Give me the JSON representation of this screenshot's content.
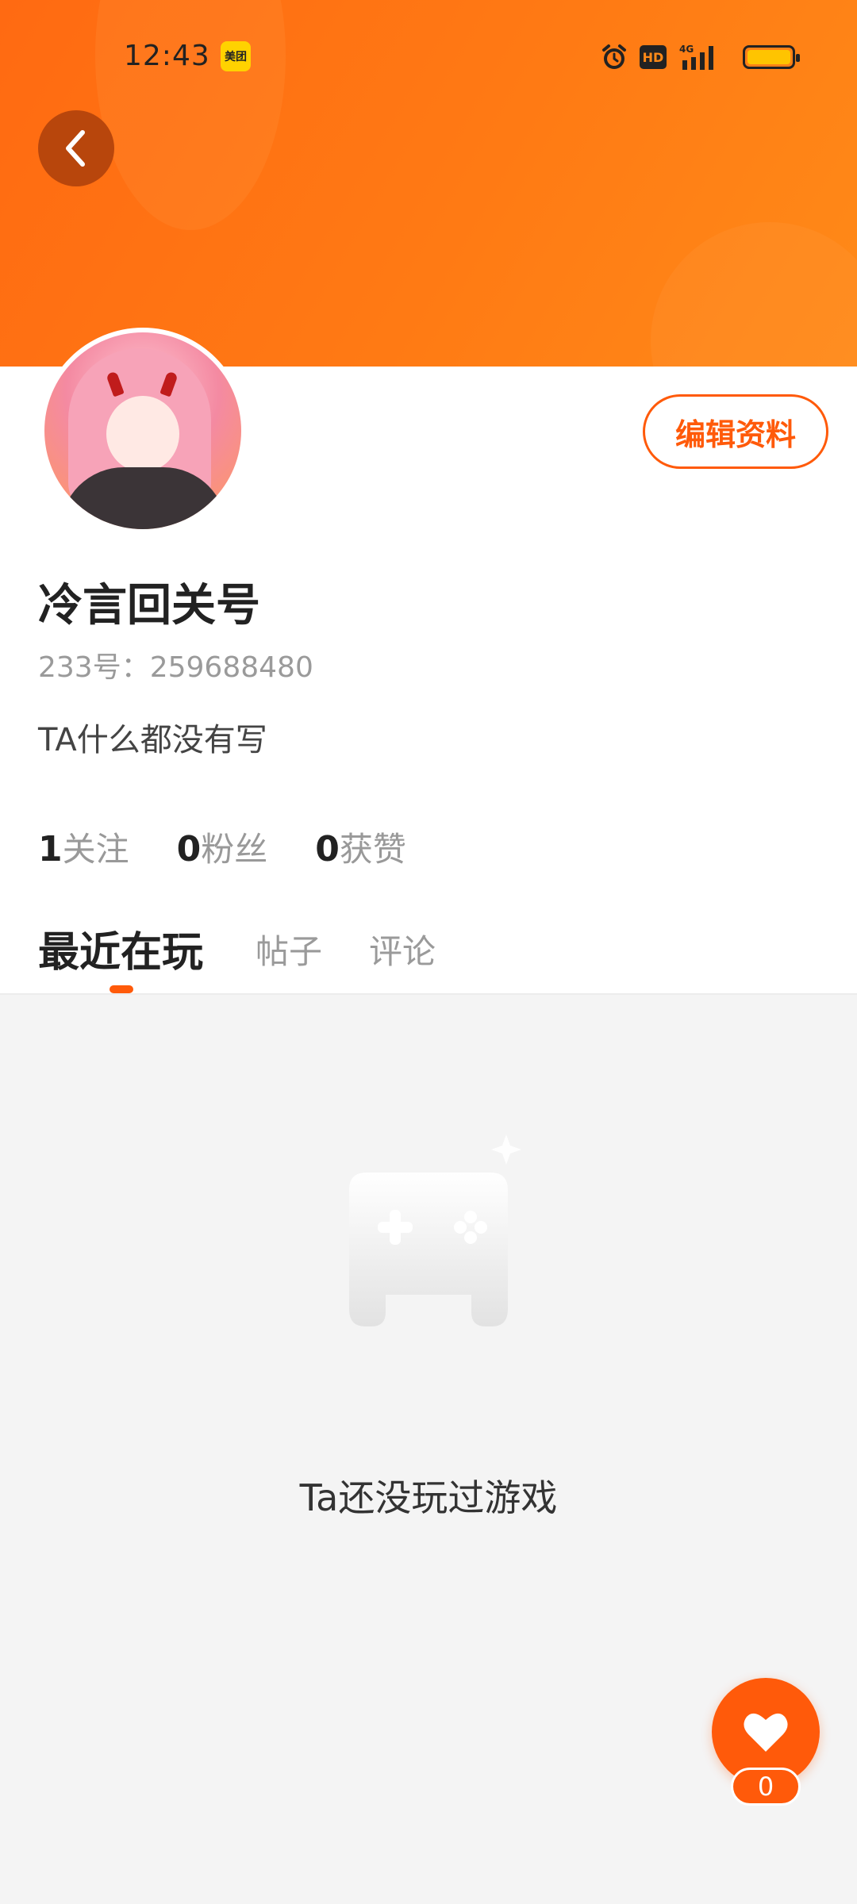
{
  "status_bar": {
    "time": "12:43",
    "app_badge": "美团",
    "icons": [
      "alarm-icon",
      "hd-icon",
      "signal-4g-icon",
      "battery-icon"
    ],
    "hd_label": "HD"
  },
  "header": {
    "back_icon": "chevron-left-icon",
    "accent": "#ff6a12"
  },
  "profile": {
    "edit_button": "编辑资料",
    "username": "冷言回关号",
    "user_id": "233号：259688480",
    "bio": "TA什么都没有写",
    "stats": [
      {
        "num": "1",
        "label": "关注"
      },
      {
        "num": "0",
        "label": "粉丝"
      },
      {
        "num": "0",
        "label": "获赞"
      }
    ]
  },
  "tabs": [
    {
      "label": "最近在玩",
      "active": true
    },
    {
      "label": "帖子",
      "active": false
    },
    {
      "label": "评论",
      "active": false
    }
  ],
  "empty_state": {
    "icon": "gamepad-icon",
    "text": "Ta还没玩过游戏"
  },
  "like": {
    "icon": "heart-icon",
    "count": "0"
  }
}
